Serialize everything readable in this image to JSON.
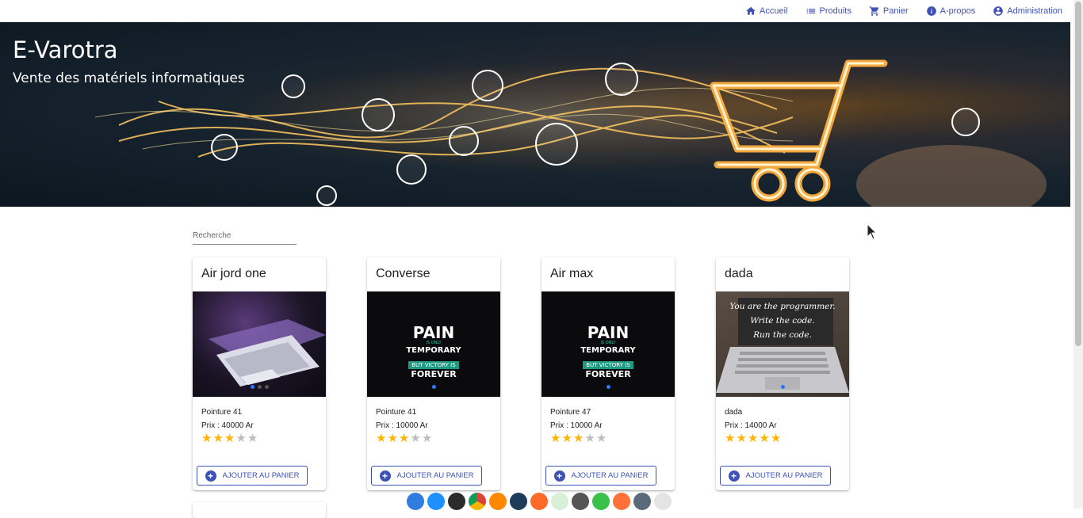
{
  "nav": [
    {
      "label": "Accueil",
      "icon": "home-icon"
    },
    {
      "label": "Produits",
      "icon": "list-icon"
    },
    {
      "label": "Panier",
      "icon": "cart-icon"
    },
    {
      "label": "A-propos",
      "icon": "info-icon"
    },
    {
      "label": "Administration",
      "icon": "account-icon"
    }
  ],
  "hero": {
    "title": "E-Varotra",
    "subtitle": "Vente des matériels informatiques"
  },
  "search": {
    "placeholder": "Recherche"
  },
  "products": [
    {
      "name": "Air jord one",
      "line1": "Pointure 41",
      "line2": "Prix : 40000 Ar",
      "rating": 3,
      "max": 5,
      "image": "laptop-dark"
    },
    {
      "name": "Converse",
      "line1": "Pointure 41",
      "line2": "Prix : 10000 Ar",
      "rating": 3,
      "max": 5,
      "image": "pain-poster"
    },
    {
      "name": "Air max",
      "line1": "Pointure 47",
      "line2": "Prix : 10000 Ar",
      "rating": 3,
      "max": 5,
      "image": "pain-poster"
    },
    {
      "name": "dada",
      "line1": "dada",
      "line2": "Prix : 14000 Ar",
      "rating": 5,
      "max": 5,
      "image": "programmer-laptop"
    }
  ],
  "add_button_label": "AJOUTER AU PANIER",
  "poster": {
    "pain": "PAIN",
    "is_only": "IS ONLY",
    "temporary": "TEMPORARY",
    "but_victory": "BUT VICTORY IS",
    "forever": "FOREVER"
  },
  "programmer": {
    "l1": "You are the programmer.",
    "l2": "Write the code.",
    "l3": "Run the code."
  },
  "colors": {
    "accent": "#3f51b5",
    "star": "#ffb400",
    "star_off": "#bdbdbd"
  }
}
